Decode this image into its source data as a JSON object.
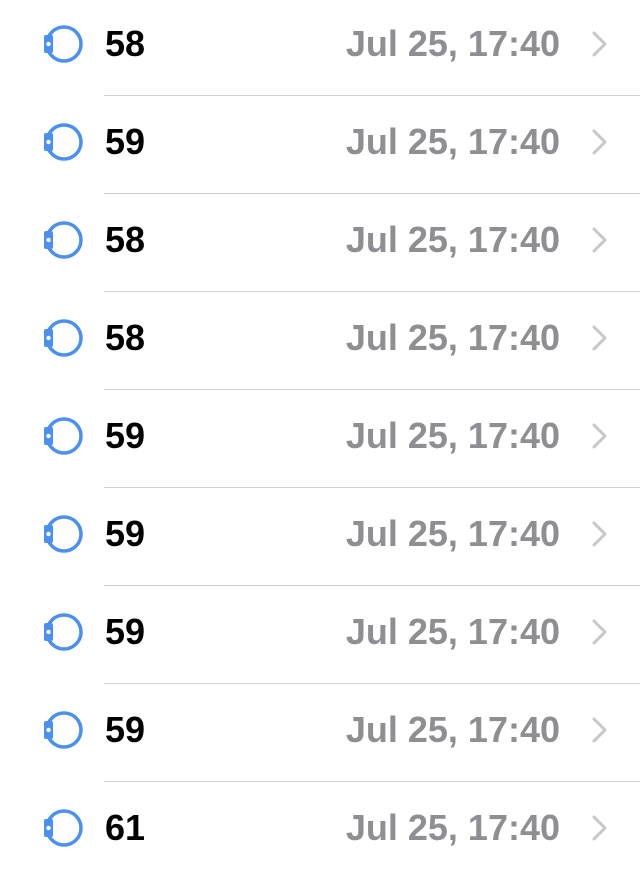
{
  "colors": {
    "accent": "#4a90f0",
    "value_text": "#000000",
    "date_text": "#8e8e93",
    "chevron": "#c7c7cc",
    "separator": "#d1d1d6"
  },
  "row_icon": "apple-watch-icon",
  "row_chevron_icon": "chevron-right-icon",
  "rows": [
    {
      "value": "58",
      "date": "Jul 25, 17:40"
    },
    {
      "value": "59",
      "date": "Jul 25, 17:40"
    },
    {
      "value": "58",
      "date": "Jul 25, 17:40"
    },
    {
      "value": "58",
      "date": "Jul 25, 17:40"
    },
    {
      "value": "59",
      "date": "Jul 25, 17:40"
    },
    {
      "value": "59",
      "date": "Jul 25, 17:40"
    },
    {
      "value": "59",
      "date": "Jul 25, 17:40"
    },
    {
      "value": "59",
      "date": "Jul 25, 17:40"
    },
    {
      "value": "61",
      "date": "Jul 25, 17:40"
    }
  ]
}
